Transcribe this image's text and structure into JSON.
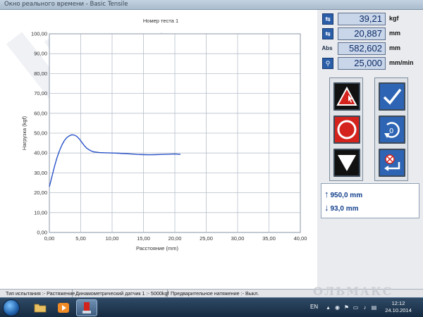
{
  "window": {
    "title": "Окно реального времени - Basic Tensile"
  },
  "chart_data": {
    "type": "line",
    "title": "Номер теста 1",
    "xlabel": "Расстояние (mm)",
    "ylabel": "Нагрузка (kgf)",
    "xlim": [
      0,
      40
    ],
    "ylim": [
      0,
      100
    ],
    "xticks": [
      "0,00",
      "5,00",
      "10,00",
      "15,00",
      "20,00",
      "25,00",
      "30,00",
      "35,00",
      "40,00"
    ],
    "yticks": [
      "0,00",
      "10,00",
      "20,00",
      "30,00",
      "40,00",
      "50,00",
      "60,00",
      "70,00",
      "80,00",
      "90,00",
      "100,00"
    ],
    "grid": true,
    "series": [
      {
        "color": "#2a53c9",
        "x": [
          0,
          0.4,
          0.8,
          1.2,
          1.6,
          2.0,
          2.4,
          2.8,
          3.2,
          3.6,
          4.0,
          4.4,
          4.8,
          5.2,
          5.6,
          6.0,
          6.5,
          7.0,
          8.0,
          9.0,
          10.0,
          11.0,
          12.0,
          13.0,
          14.0,
          15.0,
          16.0,
          17.0,
          18.0,
          19.0,
          20.0,
          20.5,
          20.9
        ],
        "y": [
          23.0,
          28.0,
          33.0,
          37.5,
          41.0,
          44.0,
          46.3,
          47.8,
          48.7,
          49.2,
          49.0,
          48.3,
          47.0,
          45.3,
          43.6,
          42.3,
          41.3,
          40.6,
          40.2,
          40.1,
          40.0,
          39.9,
          39.7,
          39.5,
          39.3,
          39.2,
          39.1,
          39.2,
          39.3,
          39.4,
          39.5,
          39.4,
          39.3
        ]
      }
    ]
  },
  "readouts": [
    {
      "icon": "load-icon",
      "icon_glyph": "⇆",
      "value": "39,21",
      "unit": "kgf"
    },
    {
      "icon": "position-icon",
      "icon_glyph": "⇆",
      "value": "20,887",
      "unit": "mm"
    },
    {
      "icon": "abs-label",
      "icon_glyph": "Abs",
      "value": "582,602",
      "unit": "mm"
    },
    {
      "icon": "speed-icon",
      "icon_glyph": "⚲",
      "value": "25,000",
      "unit": "mm/min"
    }
  ],
  "info": {
    "up_limit": "950,0 mm",
    "down_limit": "93,0 mm"
  },
  "status": {
    "test_type": "Тип испытания :- Растяжение",
    "sensor": "Динамометрический датчик 1 :- 5000kgf",
    "pretension": "Предварительное натяжение :- Выкл."
  },
  "watermark": "ОЛЬМАКС",
  "taskbar": {
    "lang": "EN",
    "time": "12:12",
    "date": "24.10.2014"
  },
  "colors": {
    "accent": "#2d64b3",
    "stop": "#d4231d",
    "line": "#2a53c9"
  }
}
